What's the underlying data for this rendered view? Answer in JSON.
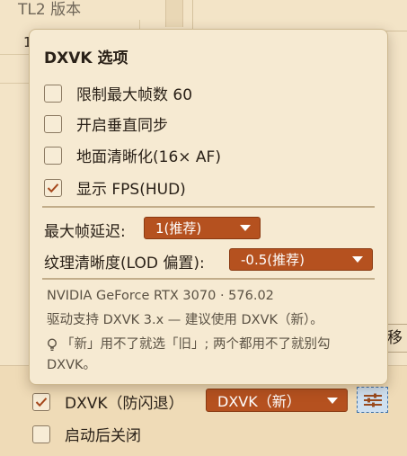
{
  "background": {
    "section_title": "TL2 版本",
    "list_first_item": "1",
    "move_button_label": "移\u0010",
    "bottom": {
      "dxvk_checkbox_label": "DXVK（防闪退）",
      "dxvk_checked": true,
      "dxvk_select_value": "DXVK（新）",
      "close_after_launch_label": "启动后关闭",
      "close_after_launch_checked": false
    }
  },
  "popup": {
    "title": "DXVK 选项",
    "options": [
      {
        "label": "限制最大帧数 60",
        "checked": false
      },
      {
        "label": "开启垂直同步",
        "checked": false
      },
      {
        "label": "地面清晰化(16× AF)",
        "checked": false
      },
      {
        "label": "显示 FPS(HUD)",
        "checked": true
      }
    ],
    "max_frame_latency_label": "最大帧延迟:",
    "max_frame_latency_value": "1(推荐)",
    "lod_bias_label": "纹理清晰度(LOD 偏置):",
    "lod_bias_value": "-0.5(推荐)",
    "gpu_info": "NVIDIA GeForce RTX 3070 · 576.02",
    "driver_note": "驱动支持 DXVK 3.x — 建议使用 DXVK（新）。",
    "tip_line1": "「新」用不了就选「旧」; 两个都用不了就别勾",
    "tip_line2": "DXVK。"
  },
  "colors": {
    "accent": "#b5511f",
    "background": "#f3e4c7",
    "popup_background": "#f6ead2"
  }
}
